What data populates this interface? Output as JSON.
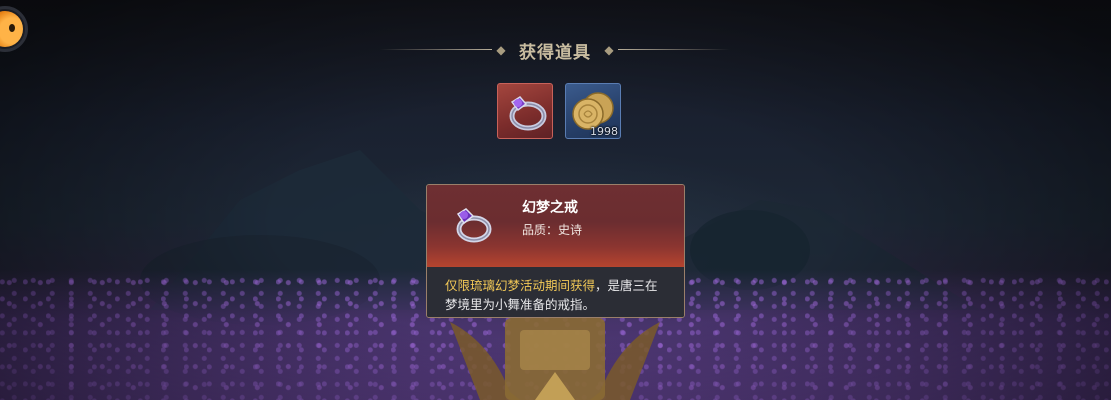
{
  "title": "获得道具",
  "items": [
    {
      "kind": "ring",
      "name_icon": "ring-icon",
      "count": ""
    },
    {
      "kind": "coin",
      "name_icon": "coin-icon",
      "count": "1998"
    }
  ],
  "tooltip": {
    "name": "幻梦之戒",
    "quality": "品质：史诗",
    "desc_highlight": "仅限琉璃幻梦活动期间获得",
    "desc_rest": "，是唐三在梦境里为小舞准备的戒指。"
  },
  "colors": {
    "epic_frame": "#a4463e",
    "blue_frame": "#3b5b8d",
    "highlight_text": "#f1c857"
  }
}
